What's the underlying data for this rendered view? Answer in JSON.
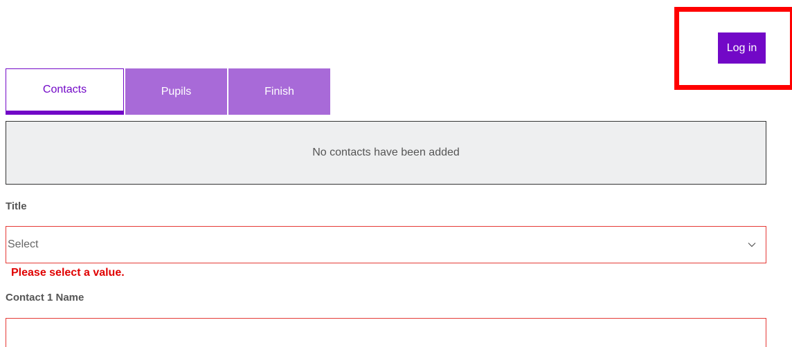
{
  "header": {
    "login_label": "Log in"
  },
  "tabs": [
    {
      "label": "Contacts",
      "active": true
    },
    {
      "label": "Pupils",
      "active": false
    },
    {
      "label": "Finish",
      "active": false
    }
  ],
  "notice": {
    "text": "No contacts have been added"
  },
  "form": {
    "title_label": "Title",
    "title_select_value": "Select",
    "title_error": "Please select a value.",
    "contact_name_label": "Contact 1 Name",
    "contact_name_value": ""
  },
  "colors": {
    "accent": "#7208c7",
    "tab_inactive": "#a86ad8",
    "error": "#e00000",
    "highlight": "#ff0000"
  },
  "icons": {
    "select_arrow": "chevron-down-icon"
  }
}
